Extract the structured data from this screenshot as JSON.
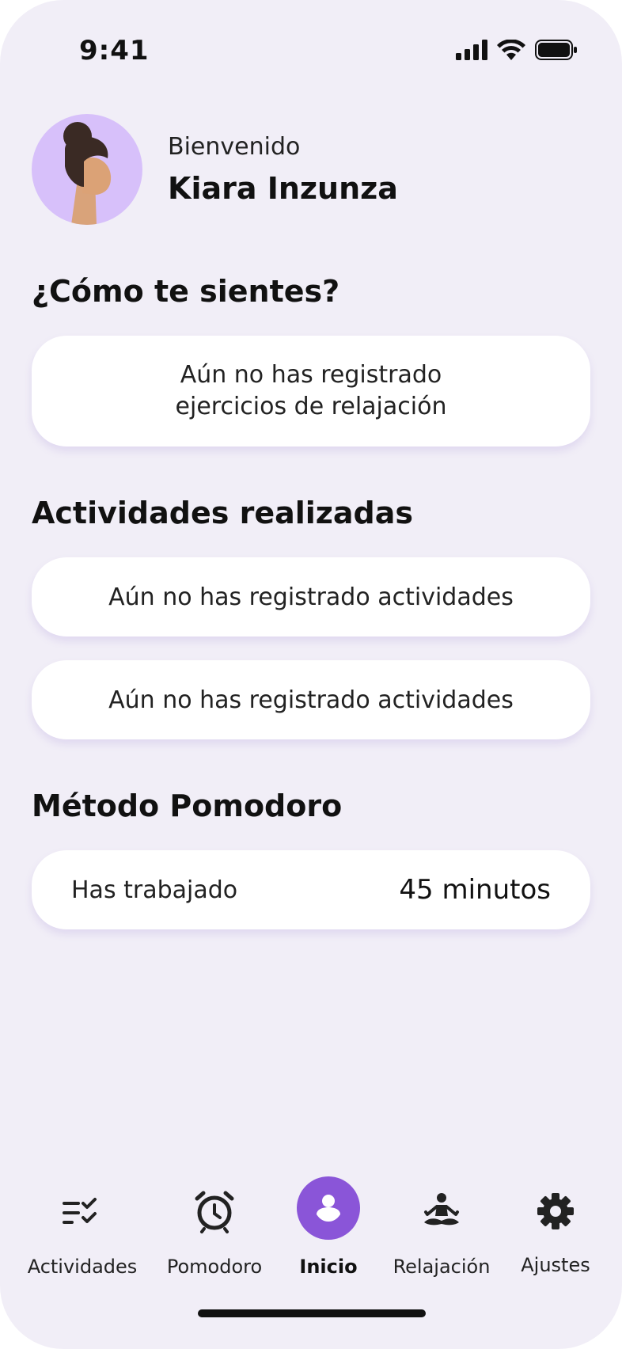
{
  "status_bar": {
    "time": "9:41"
  },
  "header": {
    "welcome": "Bienvenido",
    "user_name": "Kiara Inzunza"
  },
  "mood": {
    "title": "¿Cómo te sientes?",
    "empty_line1": "Aún no has registrado",
    "empty_line2": "ejercicios de relajación"
  },
  "activities": {
    "title": "Actividades realizadas",
    "items": [
      "Aún no has registrado actividades",
      "Aún no has registrado actividades"
    ]
  },
  "pomodoro": {
    "title": "Método Pomodoro",
    "label": "Has trabajado",
    "value": "45 minutos"
  },
  "nav": {
    "items": [
      {
        "label": "Actividades",
        "icon": "checklist-icon"
      },
      {
        "label": "Pomodoro",
        "icon": "alarm-clock-icon"
      },
      {
        "label": "Inicio",
        "icon": "user-icon",
        "active": true
      },
      {
        "label": "Relajación",
        "icon": "meditation-icon"
      },
      {
        "label": "Ajustes",
        "icon": "gear-icon"
      }
    ]
  },
  "colors": {
    "background": "#f1eef7",
    "accent": "#8a55d8",
    "avatar_bg": "#d7c0fa",
    "card": "#ffffff"
  }
}
